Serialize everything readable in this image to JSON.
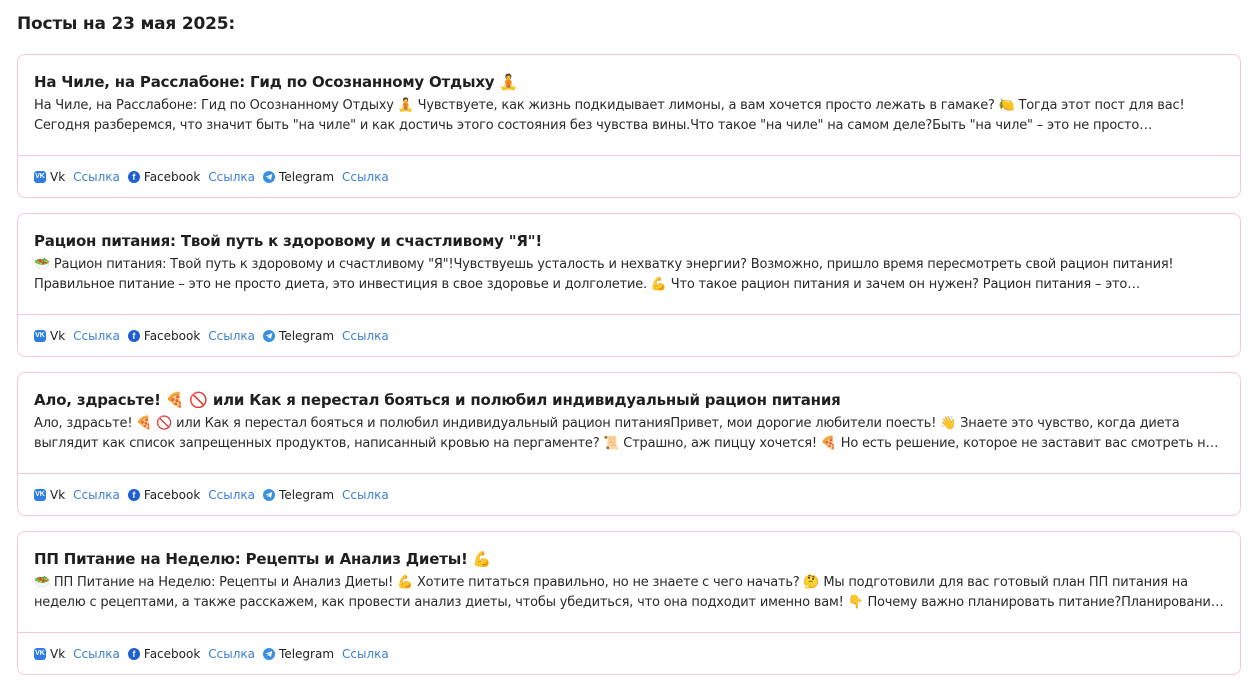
{
  "page": {
    "title": "Посты на 23 мая 2025:"
  },
  "posts": [
    {
      "title": "На Чиле, на Расслабоне: Гид по Осознанному Отдыху 🧘",
      "text": "На Чиле, на Расслабоне: Гид по Осознанному Отдыху 🧘 Чувствуете, как жизнь подкидывает лимоны, а вам хочется просто лежать в гамаке? 🍋 Тогда этот пост для вас! Сегодня разберемся, что значит быть \"на чиле\" и как достичь этого состояния без чувства вины.Что такое \"на чиле\" на самом деле?Быть \"на чиле\" – это не просто бездельничать. Это..."
    },
    {
      "title": "Рацион питания: Твой путь к здоровому и счастливому \"Я\"!",
      "text": "🥗 Рацион питания: Твой путь к здоровому и счастливому \"Я\"!Чувствуешь усталость и нехватку энергии? Возможно, пришло время пересмотреть свой рацион питания! Правильное питание – это не просто диета, это инвестиция в свое здоровье и долголетие. 💪 Что такое рацион питания и зачем он нужен? Рацион питания – это сбалансированный набор..."
    },
    {
      "title": "Ало, здрасьте! 🍕 🚫 или Как я перестал бояться и полюбил индивидуальный рацион питания",
      "text": "Ало, здрасьте! 🍕 🚫 или Как я перестал бояться и полюбил индивидуальный рацион питанияПривет, мои дорогие любители поесть! 👋 Знаете это чувство, когда диета выглядит как список запрещенных продуктов, написанный кровью на пергаменте? 📜 Страшно, аж пиццу хочется! 🍕 Но есть решение, которое не заставит вас смотреть на холодильник со..."
    },
    {
      "title": "ПП Питание на Неделю: Рецепты и Анализ Диеты! 💪",
      "text": "🥗 ПП Питание на Неделю: Рецепты и Анализ Диеты! 💪 Хотите питаться правильно, но не знаете с чего начать? 🤔 Мы подготовили для вас готовый план ПП питания на неделю с рецептами, а также расскажем, как провести анализ диеты, чтобы убедиться, что она подходит именно вам! 👇 Почему важно планировать питание?Планирование питания – это..."
    }
  ],
  "networks": {
    "vk": "Vk",
    "facebook": "Facebook",
    "telegram": "Telegram",
    "link": "Ссылка"
  },
  "icons": {
    "vk": "vk-icon",
    "facebook": "facebook-icon",
    "telegram": "telegram-icon"
  },
  "colors": {
    "border": "#f6c9d7",
    "link": "#3b7fd6",
    "vk": "#2f7de1",
    "facebook": "#1f5fd0",
    "telegram": "#3a8fde"
  }
}
